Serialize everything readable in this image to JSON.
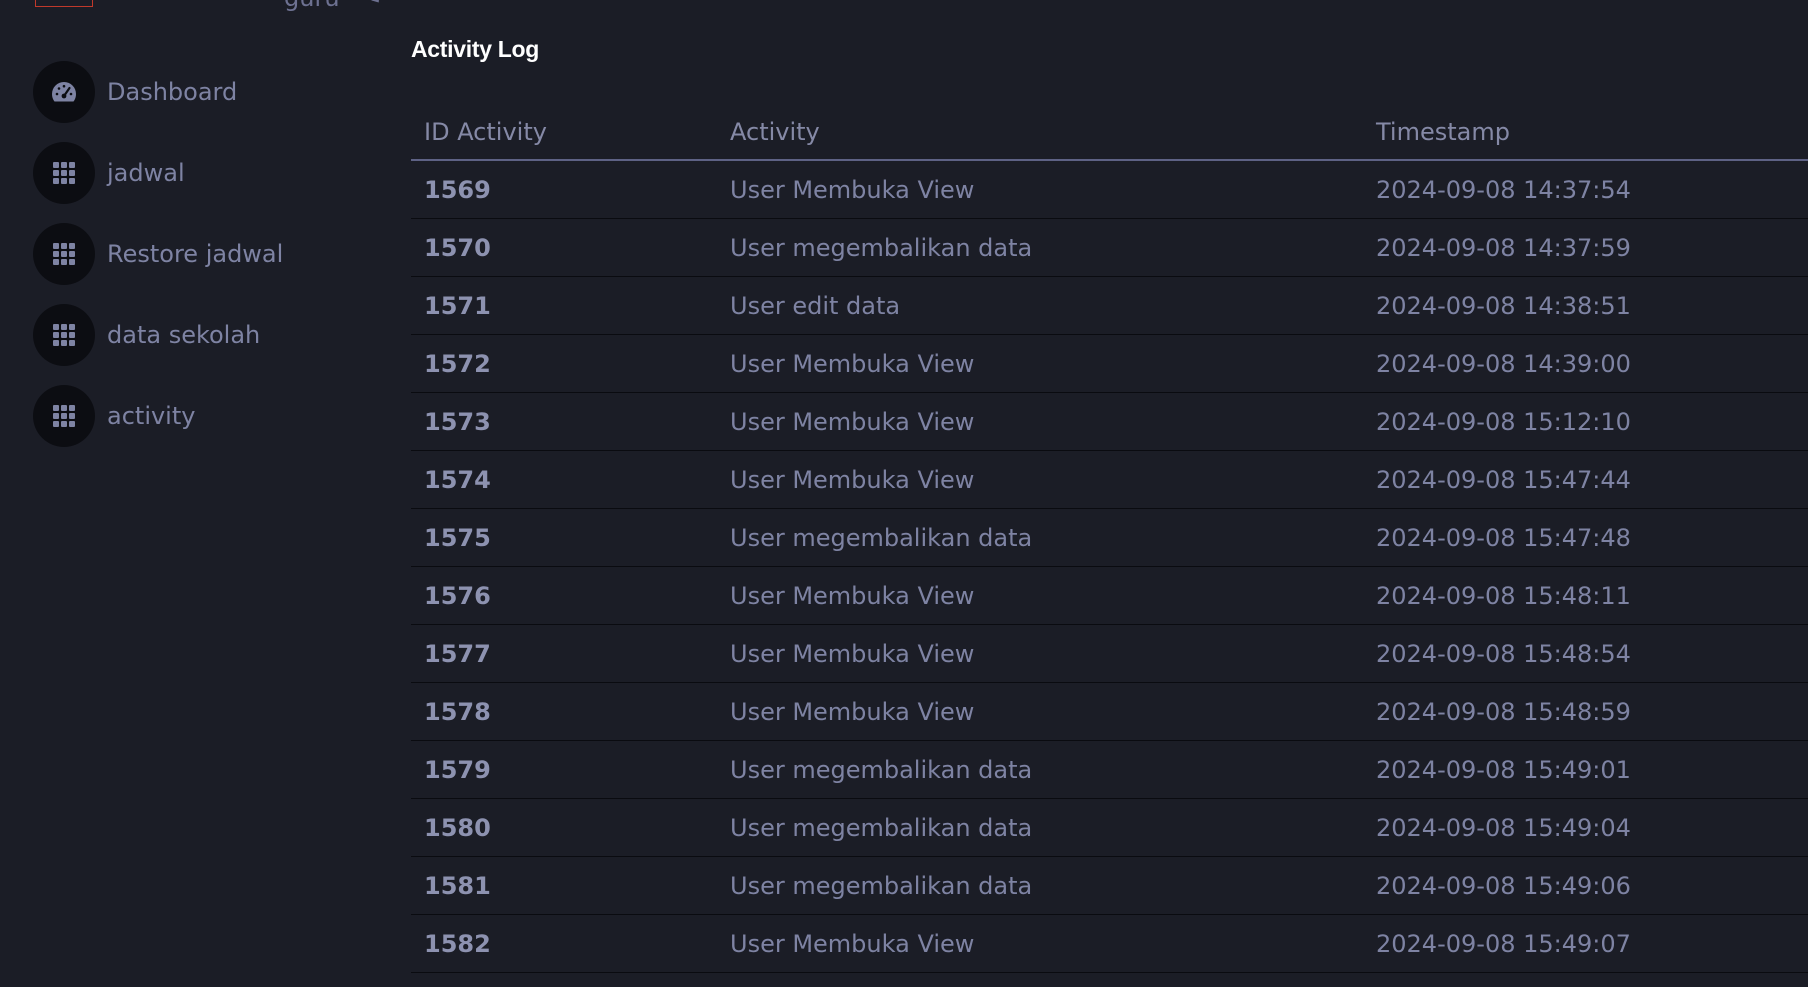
{
  "header": {
    "user_name": "guru"
  },
  "sidebar": {
    "items": [
      {
        "label": "Dashboard",
        "icon": "gauge-icon"
      },
      {
        "label": "jadwal",
        "icon": "grid-icon"
      },
      {
        "label": "Restore jadwal",
        "icon": "grid-icon"
      },
      {
        "label": "data sekolah",
        "icon": "grid-icon"
      },
      {
        "label": "activity",
        "icon": "grid-icon"
      }
    ]
  },
  "main": {
    "title": "Activity Log",
    "table": {
      "headers": [
        "ID Activity",
        "Activity",
        "Timestamp"
      ],
      "rows": [
        {
          "id": "1569",
          "activity": "User Membuka View",
          "timestamp": "2024-09-08 14:37:54"
        },
        {
          "id": "1570",
          "activity": "User megembalikan data",
          "timestamp": "2024-09-08 14:37:59"
        },
        {
          "id": "1571",
          "activity": "User edit data",
          "timestamp": "2024-09-08 14:38:51"
        },
        {
          "id": "1572",
          "activity": "User Membuka View",
          "timestamp": "2024-09-08 14:39:00"
        },
        {
          "id": "1573",
          "activity": "User Membuka View",
          "timestamp": "2024-09-08 15:12:10"
        },
        {
          "id": "1574",
          "activity": "User Membuka View",
          "timestamp": "2024-09-08 15:47:44"
        },
        {
          "id": "1575",
          "activity": "User megembalikan data",
          "timestamp": "2024-09-08 15:47:48"
        },
        {
          "id": "1576",
          "activity": "User Membuka View",
          "timestamp": "2024-09-08 15:48:11"
        },
        {
          "id": "1577",
          "activity": "User Membuka View",
          "timestamp": "2024-09-08 15:48:54"
        },
        {
          "id": "1578",
          "activity": "User Membuka View",
          "timestamp": "2024-09-08 15:48:59"
        },
        {
          "id": "1579",
          "activity": "User megembalikan data",
          "timestamp": "2024-09-08 15:49:01"
        },
        {
          "id": "1580",
          "activity": "User megembalikan data",
          "timestamp": "2024-09-08 15:49:04"
        },
        {
          "id": "1581",
          "activity": "User megembalikan data",
          "timestamp": "2024-09-08 15:49:06"
        },
        {
          "id": "1582",
          "activity": "User Membuka View",
          "timestamp": "2024-09-08 15:49:07"
        }
      ]
    }
  },
  "colors": {
    "background": "#1b1d26",
    "text_muted": "#7e83a3",
    "icon_bg": "#0c0d12",
    "title": "#ffffff",
    "logo_border": "#c0392b"
  }
}
